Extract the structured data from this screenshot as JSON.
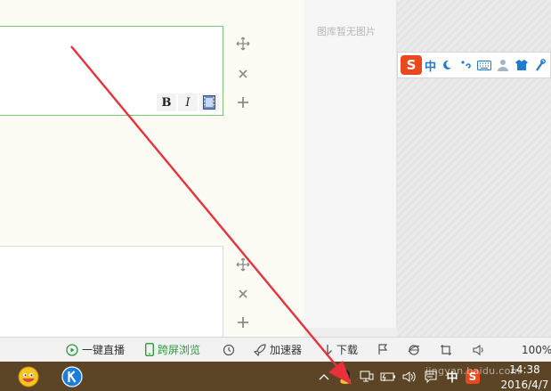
{
  "editor": {
    "formatting": {
      "bold": "B",
      "italic": "I"
    }
  },
  "gallery": {
    "empty_text": "图库暂无图片"
  },
  "ime": {
    "logo": "S",
    "lang": "中"
  },
  "statusbar": {
    "live": "一键直播",
    "cross_screen": "跨屏浏览",
    "accelerator": "加速器",
    "download": "下载",
    "zoom": "100%"
  },
  "tray": {
    "ime_lang": "中",
    "sogou": "S"
  },
  "clock": {
    "time": "14:38",
    "date": "2016/4/7"
  },
  "watermark": "jingyan.baidu.com",
  "colors": {
    "accent_green": "#7cc576",
    "arrow_red": "#e8313a",
    "taskbar": "#5b4526",
    "sogou": "#e8491d",
    "ime_blue": "#1e7bd1"
  }
}
